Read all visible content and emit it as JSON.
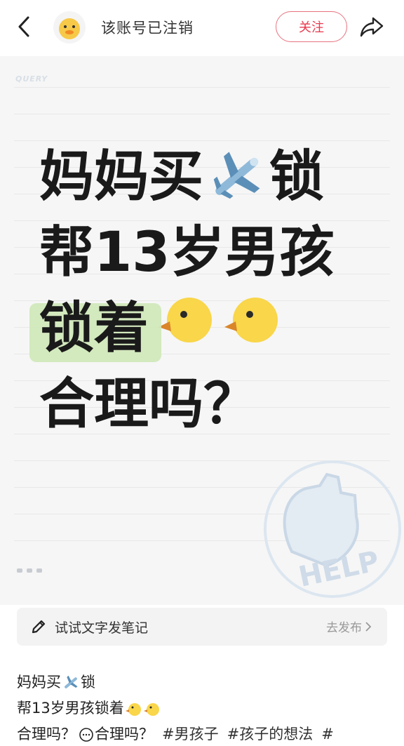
{
  "header": {
    "username": "该账号已注销",
    "follow_label": "关注"
  },
  "post_image": {
    "brand": "QUERY",
    "line1_a": "妈妈买",
    "line1_b": "锁",
    "line2": "帮13岁男孩",
    "line3_hl": "锁着",
    "line4": "合理吗？",
    "help_text": "HELP"
  },
  "try_bar": {
    "label": "试试文字发笔记",
    "action": "去发布"
  },
  "caption": {
    "line1_a": "妈妈买",
    "line1_b": "锁",
    "line2": "帮13岁男孩锁着",
    "line3_a": "合理吗？",
    "line3_b": "合理吗？",
    "tags": [
      "#男孩子",
      "#孩子的想法",
      "#"
    ]
  },
  "colors": {
    "accent": "#e8394d",
    "highlight": "#cfe8b8"
  }
}
